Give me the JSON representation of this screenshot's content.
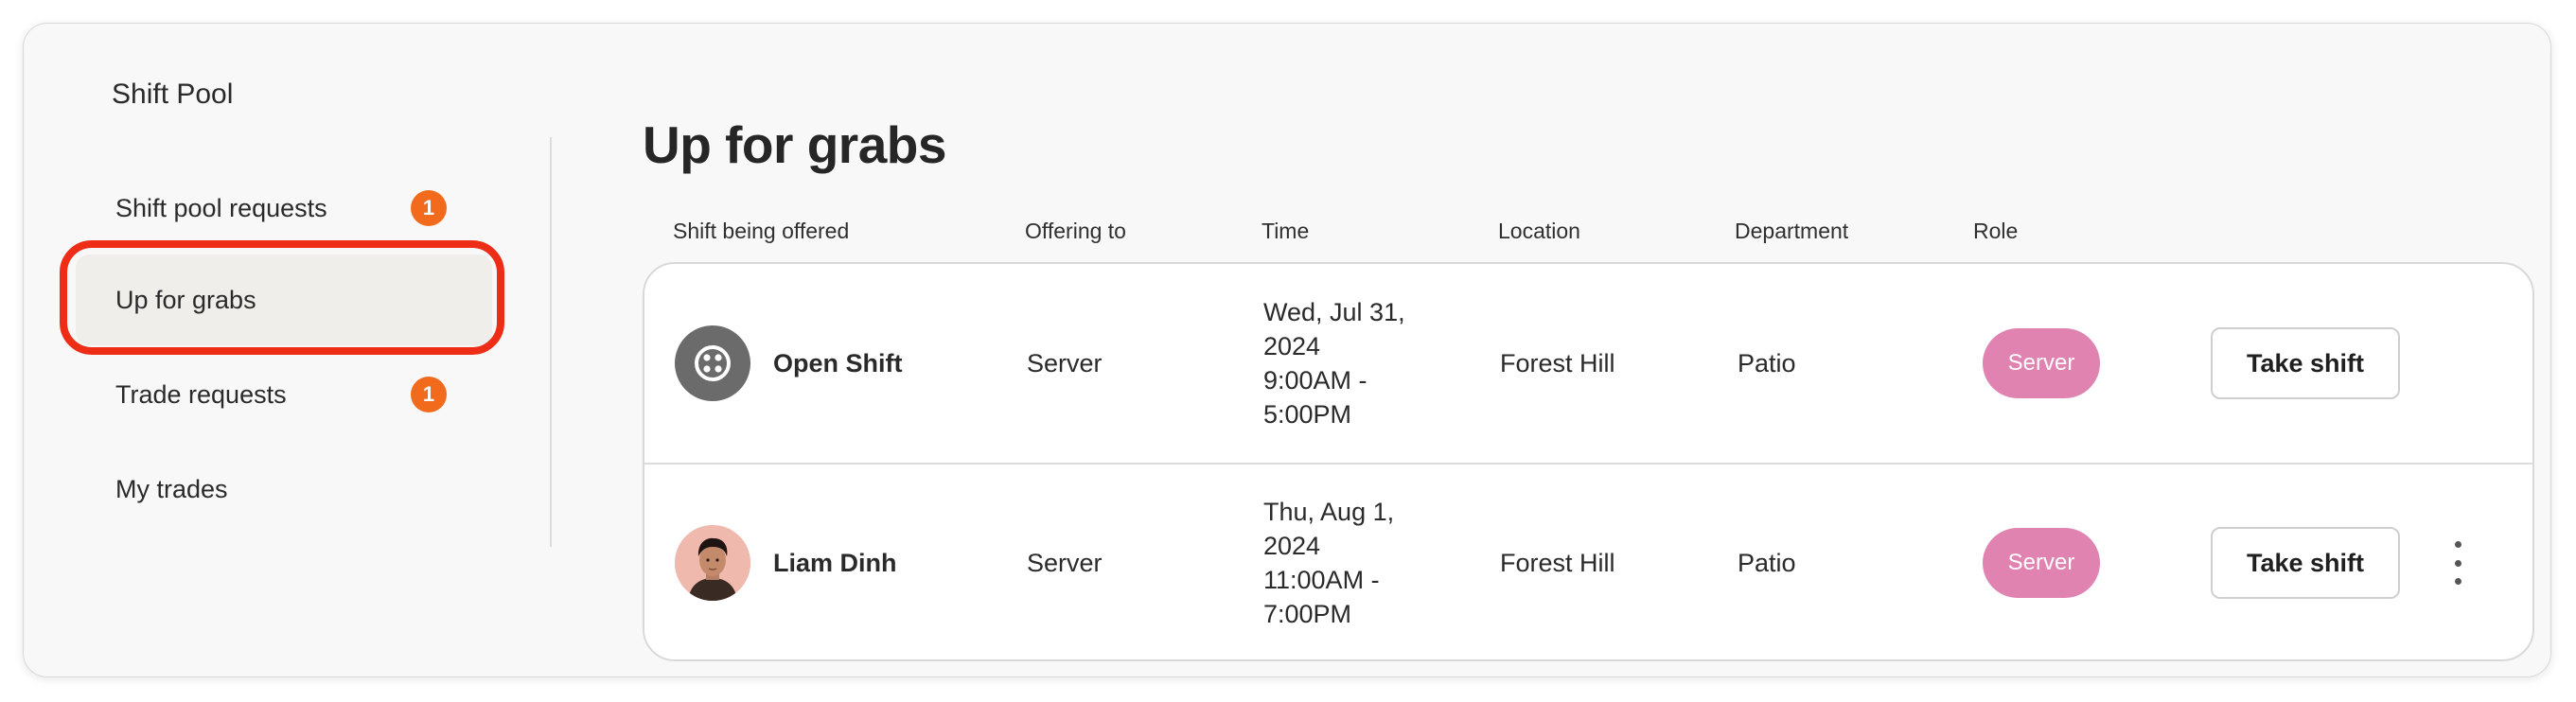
{
  "app": {
    "title": "Shift Pool"
  },
  "sidebar": {
    "items": [
      {
        "label": "Shift pool requests",
        "badge": "1"
      },
      {
        "label": "Up for grabs"
      },
      {
        "label": "Trade requests",
        "badge": "1"
      },
      {
        "label": "My trades"
      }
    ],
    "active_item": "Up for grabs"
  },
  "main": {
    "title": "Up for grabs",
    "columns": [
      "Shift being offered",
      "Offering to",
      "Time",
      "Location",
      "Department",
      "Role"
    ],
    "rows": [
      {
        "avatar_icon": "open-shift-icon",
        "name": "Open Shift",
        "offering_to": "Server",
        "time_line1": "Wed, Jul 31,",
        "time_line2": "2024",
        "time_line3": "9:00AM -",
        "time_line4": "5:00PM",
        "location": "Forest Hill",
        "department": "Patio",
        "role": "Server",
        "action": "Take shift"
      },
      {
        "avatar_icon": "person-avatar",
        "name": "Liam Dinh",
        "offering_to": "Server",
        "time_line1": "Thu, Aug 1,",
        "time_line2": "2024",
        "time_line3": "11:00AM -",
        "time_line4": "7:00PM",
        "location": "Forest Hill",
        "department": "Patio",
        "role": "Server",
        "action": "Take shift",
        "menu_icon": "more-vertical-icon"
      }
    ]
  },
  "colors": {
    "badge": "#f26a1b",
    "role_pill": "#e083b1",
    "highlight": "#ee2d17",
    "active_nav": "#efeeeb"
  }
}
